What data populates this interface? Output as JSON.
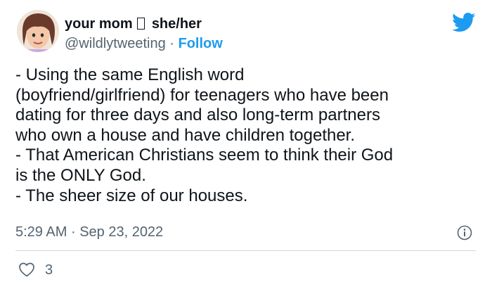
{
  "tweet": {
    "display_name": "your mom",
    "pronouns": "she/her",
    "handle": "@wildlytweeting",
    "separator": "·",
    "follow_label": "Follow",
    "text_lines": [
      "- Using the same English word",
      "(boyfriend/girlfriend) for teenagers who have been",
      "dating for three days and also long-term partners",
      "who own a house and have children together.",
      "- That American Christians seem to think their God",
      "is the ONLY God.",
      "- The sheer size of our houses."
    ],
    "time": "5:29 AM",
    "date": "Sep 23, 2022",
    "like_count": "3"
  },
  "icons": {
    "brand": "twitter-bird-icon",
    "info": "info-icon",
    "like": "heart-icon",
    "pronoun_emoji": "missing-glyph-box-icon"
  },
  "colors": {
    "brand_blue": "#1d9bf0",
    "text_primary": "#0f1419",
    "text_secondary": "#536471",
    "divider": "#cfd9de"
  }
}
